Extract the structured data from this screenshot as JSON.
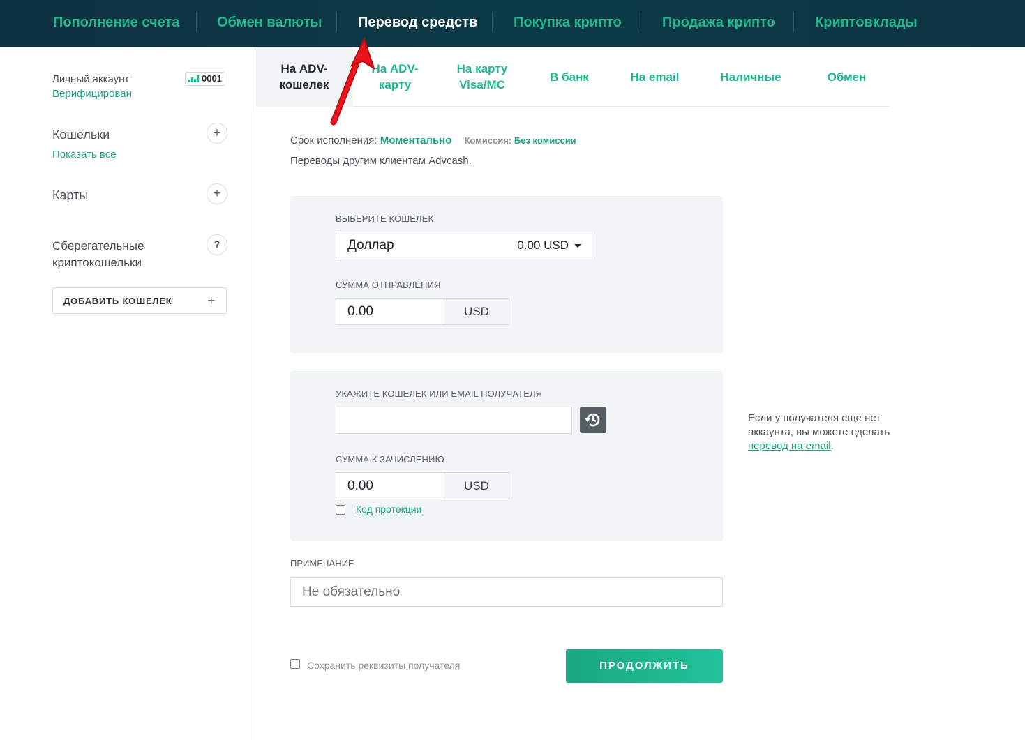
{
  "topnav": {
    "items": [
      {
        "label": "Пополнение счета",
        "active": false
      },
      {
        "label": "Обмен валюты",
        "active": false
      },
      {
        "label": "Перевод средств",
        "active": true
      },
      {
        "label": "Покупка крипто",
        "active": false
      },
      {
        "label": "Продажа крипто",
        "active": false
      },
      {
        "label": "Криптовклады",
        "active": false
      }
    ]
  },
  "sidebar": {
    "account_label": "Личный аккаунт",
    "account_status": "Верифицирован",
    "account_badge": "0001",
    "wallets_title": "Кошельки",
    "show_all": "Показать все",
    "cards_title": "Карты",
    "savings_title_line1": "Сберегательные",
    "savings_title_line2": "криптокошельки",
    "add_wallet": "ДОБАВИТЬ КОШЕЛЕК",
    "plus": "+",
    "help": "?"
  },
  "subtabs": [
    {
      "label": "На ADV-\nкошелек",
      "active": true
    },
    {
      "label": "На ADV-\nкарту",
      "active": false
    },
    {
      "label": "На карту\nVisa/MC",
      "active": false
    },
    {
      "label": "В банк",
      "active": false
    },
    {
      "label": "На email",
      "active": false
    },
    {
      "label": "Наличные",
      "active": false
    },
    {
      "label": "Обмен",
      "active": false
    }
  ],
  "info": {
    "term_label": "Срок исполнения:",
    "term_value": "Моментально",
    "fee_label": "Комиссия:",
    "fee_value": "Без комиссии",
    "description": "Переводы другим клиентам Advcash."
  },
  "sender": {
    "wallet_label": "ВЫБЕРИТЕ КОШЕЛЕК",
    "wallet_name": "Доллар",
    "wallet_balance": "0.00 USD",
    "amount_label": "СУММА ОТПРАВЛЕНИЯ",
    "amount_value": "0.00",
    "currency": "USD"
  },
  "recipient": {
    "wallet_label": "УКАЖИТЕ КОШЕЛЕК ИЛИ EMAIL ПОЛУЧАТЕЛЯ",
    "wallet_value": "",
    "amount_label": "СУММА К ЗАЧИСЛЕНИЮ",
    "amount_value": "0.00",
    "currency": "USD",
    "protection_label": "Код протекции"
  },
  "note": {
    "label": "ПРИМЕЧАНИЕ",
    "placeholder": "Не обязательно"
  },
  "footer": {
    "save_label": "Сохранить реквизиты получателя",
    "continue_label": "ПРОДОЛЖИТЬ"
  },
  "side_note": {
    "text": "Если у получателя еще нет аккаунта, вы можете сделать ",
    "link": "перевод на email",
    "end": "."
  },
  "colors": {
    "nav_bg": "#0c3a48",
    "accent": "#1fb98e",
    "arrow": "#e8141b"
  }
}
